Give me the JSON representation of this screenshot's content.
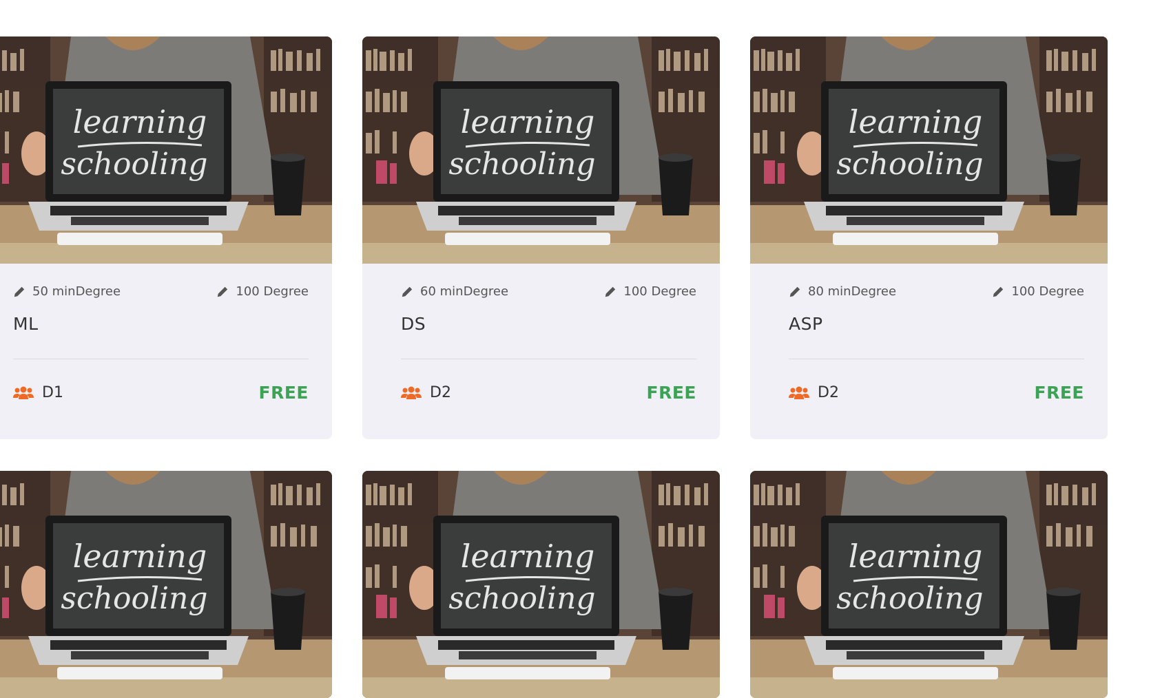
{
  "colors": {
    "card_bg": "#f1f0f6",
    "price": "#3aa354",
    "group_icon": "#ef6a27",
    "text": "#333333"
  },
  "thumbnail": {
    "chalkboard_line1": "learning",
    "chalkboard_line2": "schooling"
  },
  "courses": [
    {
      "min_degree": "50 minDegree",
      "max_degree": "100 Degree",
      "title": "ML",
      "group": "D1",
      "price": "FREE"
    },
    {
      "min_degree": "60 minDegree",
      "max_degree": "100 Degree",
      "title": "DS",
      "group": "D2",
      "price": "FREE"
    },
    {
      "min_degree": "80 minDegree",
      "max_degree": "100 Degree",
      "title": "ASP",
      "group": "D2",
      "price": "FREE"
    }
  ],
  "icons": {
    "degree": "pencil-icon",
    "group": "users-icon"
  }
}
